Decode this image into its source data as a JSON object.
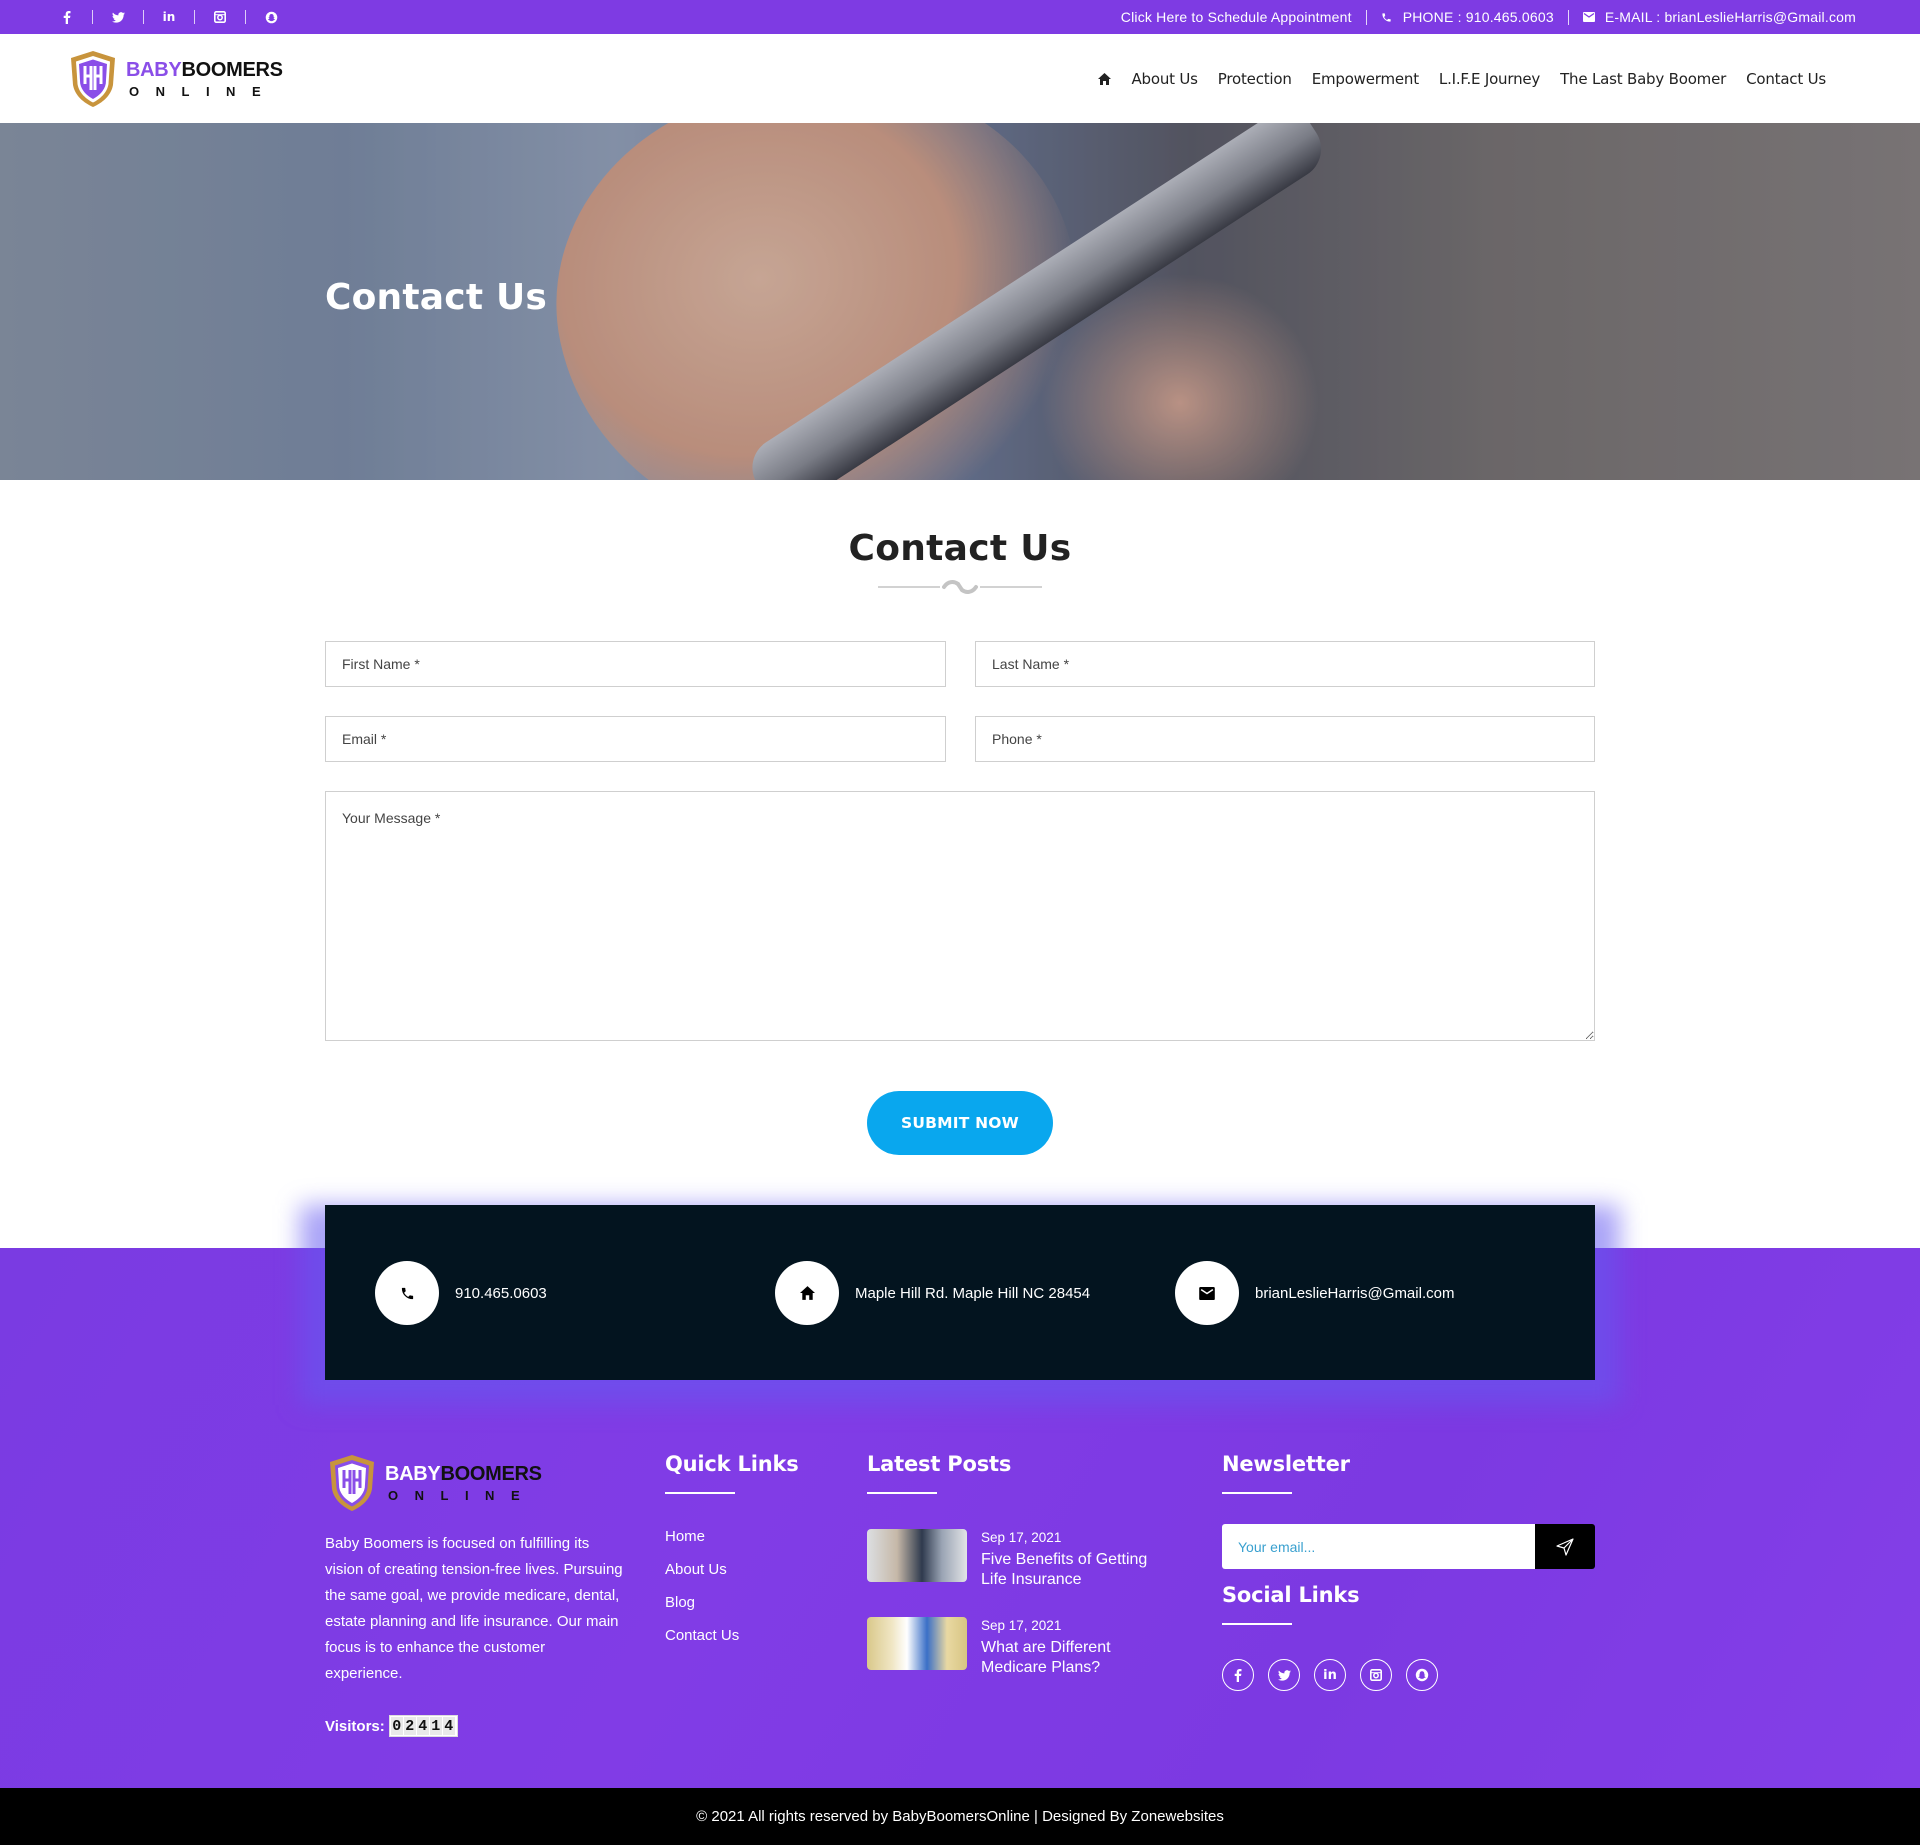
{
  "topbar": {
    "social": [
      {
        "name": "facebook",
        "glyph": "f"
      },
      {
        "name": "twitter",
        "glyph": "t"
      },
      {
        "name": "linkedin",
        "glyph": "in"
      },
      {
        "name": "instagram",
        "glyph": "ig"
      },
      {
        "name": "snapchat",
        "glyph": "sc"
      }
    ],
    "schedule_link": "Click Here to Schedule Appointment",
    "phone": "PHONE : 910.465.0603",
    "email": "E-MAIL : brianLeslieHarris@Gmail.com"
  },
  "brand": {
    "word_baby": "BABY",
    "word_boomers": "BOOMERS",
    "word_online": "ONLINE"
  },
  "nav": {
    "home_icon": "home-icon",
    "items": [
      "About Us",
      "Protection",
      "Empowerment",
      "L.I.F.E Journey",
      "The Last Baby Boomer",
      "Contact Us"
    ]
  },
  "hero": {
    "title": "Contact Us"
  },
  "form": {
    "title": "Contact Us",
    "first_name_placeholder": "First Name *",
    "last_name_placeholder": "Last Name *",
    "email_placeholder": "Email *",
    "phone_placeholder": "Phone *",
    "message_placeholder": "Your Message *",
    "submit_label": "SUBMIT NOW"
  },
  "contact_box": {
    "phone": "910.465.0603",
    "address": "Maple Hill Rd. Maple Hill NC 28454",
    "email": "brianLeslieHarris@Gmail.com"
  },
  "footer": {
    "about_text": "Baby Boomers is focused on fulfilling its vision of creating tension-free lives. Pursuing the same goal, we provide medicare, dental, estate planning and life insurance. Our main focus is to enhance the customer experience.",
    "visitors_label": "Visitors:",
    "visitor_digits": [
      "0",
      "2",
      "4",
      "1",
      "4"
    ],
    "quick_links_title": "Quick Links",
    "quick_links": [
      "Home",
      "About Us",
      "Blog",
      "Contact Us"
    ],
    "latest_posts_title": "Latest Posts",
    "posts": [
      {
        "date": "Sep 17, 2021",
        "title": "Five Benefits of Getting Life Insurance"
      },
      {
        "date": "Sep 17, 2021",
        "title": "What are Different Medicare Plans?"
      }
    ],
    "newsletter_title": "Newsletter",
    "newsletter_placeholder": "Your email...",
    "social_title": "Social Links",
    "social": [
      {
        "name": "facebook",
        "glyph": "f"
      },
      {
        "name": "twitter",
        "glyph": "t"
      },
      {
        "name": "linkedin",
        "glyph": "in"
      },
      {
        "name": "instagram",
        "glyph": "ig"
      },
      {
        "name": "snapchat",
        "glyph": "sc"
      }
    ]
  },
  "bottom_bar": {
    "copyright": "© 2021 All rights reserved by BabyBoomersOnline | Designed By Zonewebsites"
  },
  "colors": {
    "brand_purple": "#7e3be3",
    "submit_blue": "#09a7ee",
    "contact_box_bg": "#03141f",
    "logo_gold": "#c8943c"
  }
}
